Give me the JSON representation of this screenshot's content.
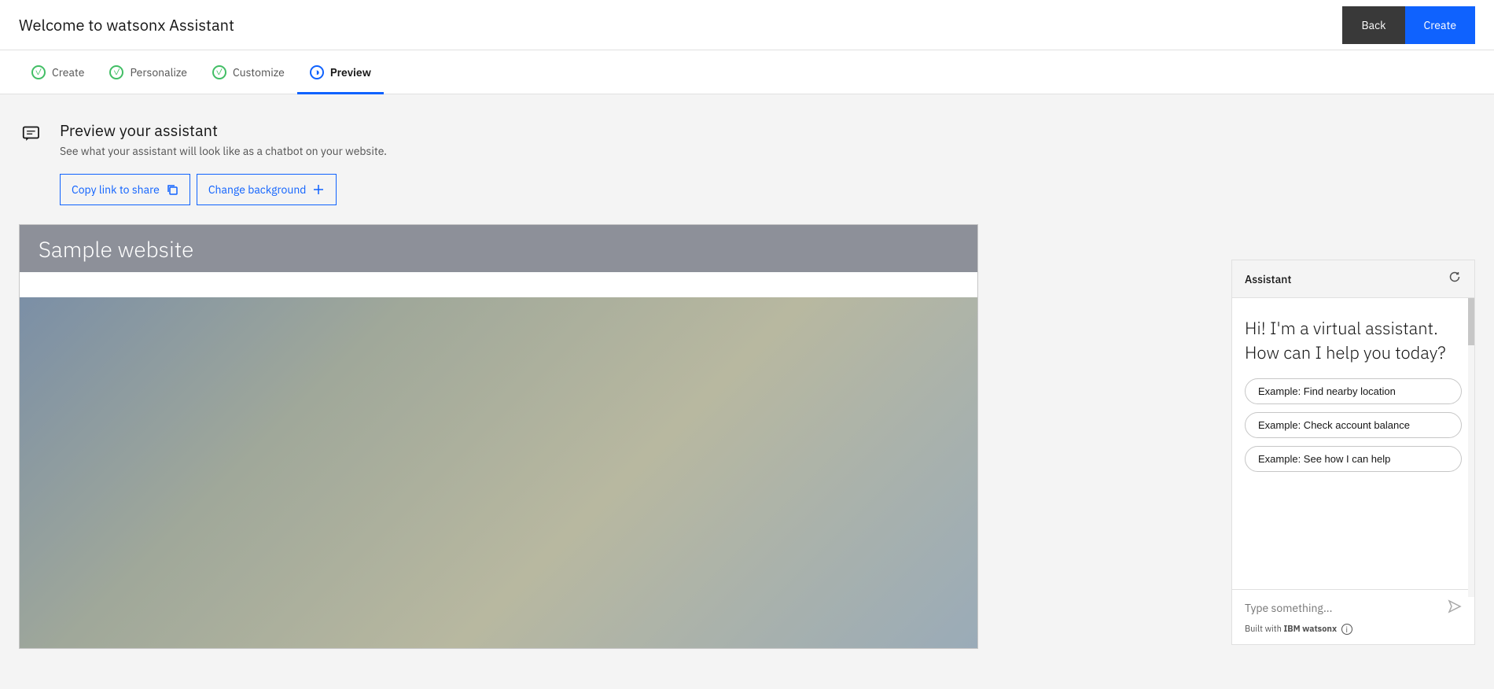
{
  "header": {
    "title": "Welcome to watsonx Assistant",
    "back_label": "Back",
    "create_label": "Create"
  },
  "steps": [
    {
      "id": "create",
      "label": "Create",
      "state": "completed",
      "icon": "✓"
    },
    {
      "id": "personalize",
      "label": "Personalize",
      "state": "completed",
      "icon": "✓"
    },
    {
      "id": "customize",
      "label": "Customize",
      "state": "completed",
      "icon": "✓"
    },
    {
      "id": "preview",
      "label": "Preview",
      "state": "active",
      "icon": "◑"
    }
  ],
  "section": {
    "title": "Preview your assistant",
    "subtitle": "See what your assistant will look like as a chatbot on your website.",
    "copy_link_label": "Copy link to share",
    "change_background_label": "Change background"
  },
  "website_preview": {
    "header_text": "Sample website"
  },
  "chat": {
    "header_title": "Assistant",
    "greeting": "Hi! I'm a virtual assistant. How can I help you today?",
    "suggestions": [
      "Example: Find nearby location",
      "Example: Check account balance",
      "Example: See how I can help"
    ],
    "input_placeholder": "Type something...",
    "powered_by_prefix": "Built with ",
    "powered_by_brand": "IBM watsonx"
  }
}
